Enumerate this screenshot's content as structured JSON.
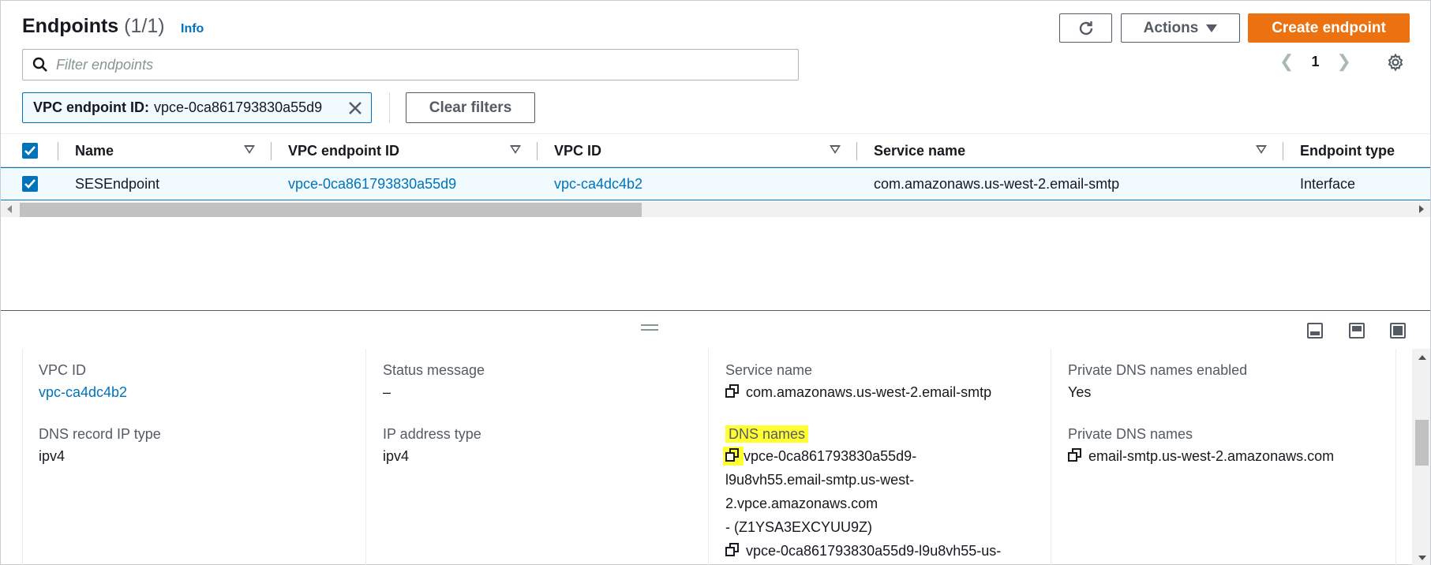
{
  "header": {
    "title": "Endpoints",
    "count": "(1/1)",
    "info": "Info",
    "actions_label": "Actions",
    "create_label": "Create endpoint"
  },
  "search": {
    "placeholder": "Filter endpoints"
  },
  "pagination": {
    "current_page": "1"
  },
  "filter_token": {
    "key": "VPC endpoint ID:",
    "value": "vpce-0ca861793830a55d9"
  },
  "clear_filters_label": "Clear filters",
  "table": {
    "columns": [
      "Name",
      "VPC endpoint ID",
      "VPC ID",
      "Service name",
      "Endpoint type"
    ],
    "rows": [
      {
        "name": "SESEndpoint",
        "endpoint_id": "vpce-0ca861793830a55d9",
        "vpc_id": "vpc-ca4dc4b2",
        "service_name": "com.amazonaws.us-west-2.email-smtp",
        "endpoint_type": "Interface",
        "selected": true
      }
    ]
  },
  "details": {
    "vpc_id_label": "VPC ID",
    "vpc_id_value": "vpc-ca4dc4b2",
    "dns_record_ip_type_label": "DNS record IP type",
    "dns_record_ip_type_value": "ipv4",
    "status_message_label": "Status message",
    "status_message_value": "–",
    "ip_address_type_label": "IP address type",
    "ip_address_type_value": "ipv4",
    "service_name_label": "Service name",
    "service_name_value": "com.amazonaws.us-west-2.email-smtp",
    "dns_names_label": "DNS names",
    "dns_names_lines": [
      "vpce-0ca861793830a55d9-",
      "l9u8vh55.email-smtp.us-west-",
      "2.vpce.amazonaws.com",
      "- (Z1YSA3EXCYUU9Z)",
      "vpce-0ca861793830a55d9-l9u8vh55-us-"
    ],
    "private_dns_enabled_label": "Private DNS names enabled",
    "private_dns_enabled_value": "Yes",
    "private_dns_names_label": "Private DNS names",
    "private_dns_names_value": "email-smtp.us-west-2.amazonaws.com"
  },
  "colors": {
    "accent": "#0073bb",
    "primary_button": "#ec7211",
    "highlight": "#ffff33"
  }
}
